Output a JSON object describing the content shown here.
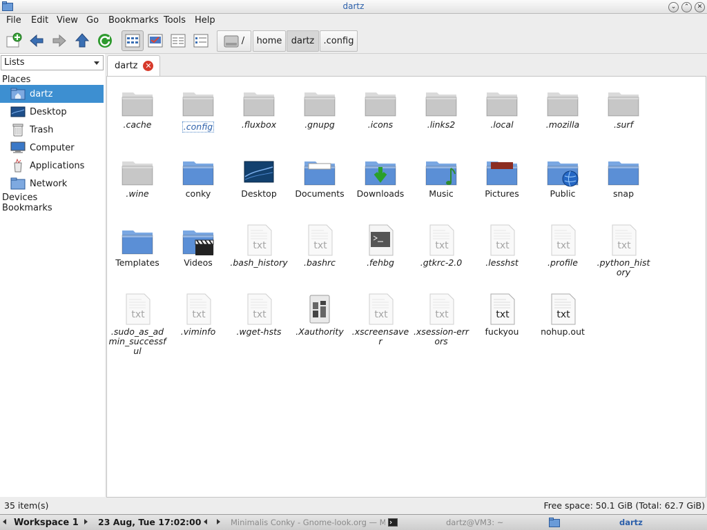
{
  "window": {
    "title": "dartz"
  },
  "menu": [
    "File",
    "Edit",
    "View",
    "Go",
    "Bookmarks",
    "Tools",
    "Help"
  ],
  "toolbar": {
    "path": [
      "/",
      "home",
      "dartz",
      ".config"
    ]
  },
  "sidebar": {
    "mode_select": "Lists",
    "places_label": "Places",
    "places": [
      {
        "label": "dartz",
        "icon": "home-folder-icon",
        "selected": true
      },
      {
        "label": "Desktop",
        "icon": "desktop-icon"
      },
      {
        "label": "Trash",
        "icon": "trash-icon"
      },
      {
        "label": "Computer",
        "icon": "computer-icon"
      },
      {
        "label": "Applications",
        "icon": "applications-icon"
      },
      {
        "label": "Network",
        "icon": "network-icon"
      }
    ],
    "devices_label": "Devices",
    "bookmarks_label": "Bookmarks"
  },
  "tab": {
    "label": "dartz"
  },
  "files": [
    {
      "name": ".cache",
      "type": "folder-grey"
    },
    {
      "name": ".config",
      "type": "folder-grey",
      "selected": true
    },
    {
      "name": ".fluxbox",
      "type": "folder-grey"
    },
    {
      "name": ".gnupg",
      "type": "folder-grey"
    },
    {
      "name": ".icons",
      "type": "folder-grey"
    },
    {
      "name": ".links2",
      "type": "folder-grey"
    },
    {
      "name": ".local",
      "type": "folder-grey"
    },
    {
      "name": ".mozilla",
      "type": "folder-grey"
    },
    {
      "name": ".surf",
      "type": "folder-grey"
    },
    {
      "name": ".wine",
      "type": "folder-grey"
    },
    {
      "name": "conky",
      "type": "folder-blue"
    },
    {
      "name": "Desktop",
      "type": "desktop"
    },
    {
      "name": "Documents",
      "type": "folder-docs"
    },
    {
      "name": "Downloads",
      "type": "folder-downloads"
    },
    {
      "name": "Music",
      "type": "folder-music"
    },
    {
      "name": "Pictures",
      "type": "folder-pictures"
    },
    {
      "name": "Public",
      "type": "folder-public"
    },
    {
      "name": "snap",
      "type": "folder-blue"
    },
    {
      "name": "Templates",
      "type": "folder-blue"
    },
    {
      "name": "Videos",
      "type": "folder-videos"
    },
    {
      "name": ".bash_history",
      "type": "txt"
    },
    {
      "name": ".bashrc",
      "type": "txt"
    },
    {
      "name": ".fehbg",
      "type": "script"
    },
    {
      "name": ".gtkrc-2.0",
      "type": "txt"
    },
    {
      "name": ".lesshst",
      "type": "txt"
    },
    {
      "name": ".profile",
      "type": "txt"
    },
    {
      "name": ".python_history",
      "type": "txt"
    },
    {
      "name": ".sudo_as_admin_successful",
      "type": "txt"
    },
    {
      "name": ".viminfo",
      "type": "txt"
    },
    {
      "name": ".wget-hsts",
      "type": "txt"
    },
    {
      "name": ".Xauthority",
      "type": "xauth"
    },
    {
      "name": ".xscreensaver",
      "type": "txt"
    },
    {
      "name": ".xsession-errors",
      "type": "txt"
    },
    {
      "name": "fuckyou",
      "type": "txt-dark"
    },
    {
      "name": "nohup.out",
      "type": "txt-dark"
    }
  ],
  "status": {
    "items": "35 item(s)",
    "space": "Free space: 50.1 GiB (Total: 62.7 GiB)"
  },
  "taskbar": {
    "workspace": "Workspace 1",
    "clock": "23 Aug, Tue 17:02:00",
    "tasks": [
      "Minimalis Conky - Gnome-look.org — M",
      "dartz@VM3: ~",
      "dartz"
    ]
  }
}
